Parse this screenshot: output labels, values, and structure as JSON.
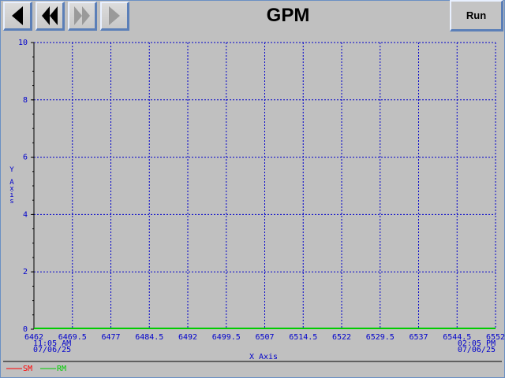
{
  "toolbar": {
    "title": "GPM",
    "run_label": "Run"
  },
  "chart_data": {
    "type": "line",
    "title": "GPM",
    "xlabel": "X Axis",
    "ylabel": "Y Axis",
    "xlim": [
      6462,
      6552
    ],
    "ylim": [
      0,
      10
    ],
    "x_ticks": [
      "6462",
      "6469.5",
      "6477",
      "6484.5",
      "6492",
      "6499.5",
      "6507",
      "6514.5",
      "6522",
      "6529.5",
      "6537",
      "6544.5",
      "6552"
    ],
    "y_ticks": [
      "0",
      "2",
      "4",
      "6",
      "8",
      "10"
    ],
    "x_start_time": "11:05 AM",
    "x_start_date": "07/06/25",
    "x_end_time": "02:05 PM",
    "x_end_date": "07/06/25",
    "grid": true,
    "legend_position": "bottom-left",
    "series": [
      {
        "name": "SM",
        "color": "#ff0000",
        "x": [],
        "y": []
      },
      {
        "name": "RM",
        "color": "#00cc00",
        "x": [
          6462,
          6552
        ],
        "y": [
          0,
          0
        ]
      }
    ],
    "colors": {
      "grid": "#0000cc",
      "text": "#0000cc",
      "axis": "#000000"
    }
  }
}
